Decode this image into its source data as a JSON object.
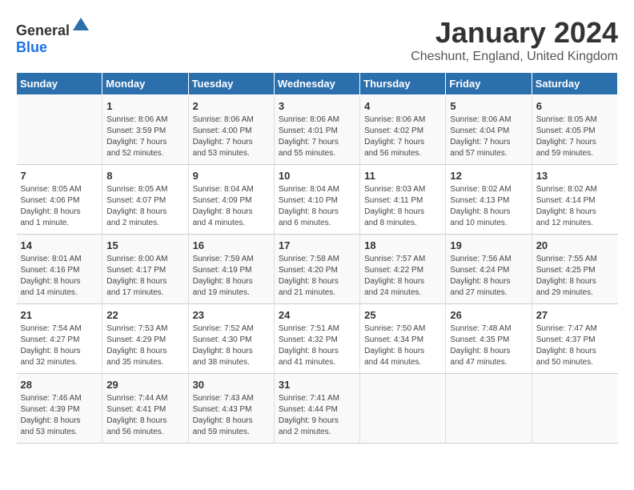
{
  "logo": {
    "text_general": "General",
    "text_blue": "Blue"
  },
  "header": {
    "title": "January 2024",
    "subtitle": "Cheshunt, England, United Kingdom"
  },
  "weekdays": [
    "Sunday",
    "Monday",
    "Tuesday",
    "Wednesday",
    "Thursday",
    "Friday",
    "Saturday"
  ],
  "weeks": [
    [
      {
        "day": "",
        "info": ""
      },
      {
        "day": "1",
        "info": "Sunrise: 8:06 AM\nSunset: 3:59 PM\nDaylight: 7 hours\nand 52 minutes."
      },
      {
        "day": "2",
        "info": "Sunrise: 8:06 AM\nSunset: 4:00 PM\nDaylight: 7 hours\nand 53 minutes."
      },
      {
        "day": "3",
        "info": "Sunrise: 8:06 AM\nSunset: 4:01 PM\nDaylight: 7 hours\nand 55 minutes."
      },
      {
        "day": "4",
        "info": "Sunrise: 8:06 AM\nSunset: 4:02 PM\nDaylight: 7 hours\nand 56 minutes."
      },
      {
        "day": "5",
        "info": "Sunrise: 8:06 AM\nSunset: 4:04 PM\nDaylight: 7 hours\nand 57 minutes."
      },
      {
        "day": "6",
        "info": "Sunrise: 8:05 AM\nSunset: 4:05 PM\nDaylight: 7 hours\nand 59 minutes."
      }
    ],
    [
      {
        "day": "7",
        "info": "Sunrise: 8:05 AM\nSunset: 4:06 PM\nDaylight: 8 hours\nand 1 minute."
      },
      {
        "day": "8",
        "info": "Sunrise: 8:05 AM\nSunset: 4:07 PM\nDaylight: 8 hours\nand 2 minutes."
      },
      {
        "day": "9",
        "info": "Sunrise: 8:04 AM\nSunset: 4:09 PM\nDaylight: 8 hours\nand 4 minutes."
      },
      {
        "day": "10",
        "info": "Sunrise: 8:04 AM\nSunset: 4:10 PM\nDaylight: 8 hours\nand 6 minutes."
      },
      {
        "day": "11",
        "info": "Sunrise: 8:03 AM\nSunset: 4:11 PM\nDaylight: 8 hours\nand 8 minutes."
      },
      {
        "day": "12",
        "info": "Sunrise: 8:02 AM\nSunset: 4:13 PM\nDaylight: 8 hours\nand 10 minutes."
      },
      {
        "day": "13",
        "info": "Sunrise: 8:02 AM\nSunset: 4:14 PM\nDaylight: 8 hours\nand 12 minutes."
      }
    ],
    [
      {
        "day": "14",
        "info": "Sunrise: 8:01 AM\nSunset: 4:16 PM\nDaylight: 8 hours\nand 14 minutes."
      },
      {
        "day": "15",
        "info": "Sunrise: 8:00 AM\nSunset: 4:17 PM\nDaylight: 8 hours\nand 17 minutes."
      },
      {
        "day": "16",
        "info": "Sunrise: 7:59 AM\nSunset: 4:19 PM\nDaylight: 8 hours\nand 19 minutes."
      },
      {
        "day": "17",
        "info": "Sunrise: 7:58 AM\nSunset: 4:20 PM\nDaylight: 8 hours\nand 21 minutes."
      },
      {
        "day": "18",
        "info": "Sunrise: 7:57 AM\nSunset: 4:22 PM\nDaylight: 8 hours\nand 24 minutes."
      },
      {
        "day": "19",
        "info": "Sunrise: 7:56 AM\nSunset: 4:24 PM\nDaylight: 8 hours\nand 27 minutes."
      },
      {
        "day": "20",
        "info": "Sunrise: 7:55 AM\nSunset: 4:25 PM\nDaylight: 8 hours\nand 29 minutes."
      }
    ],
    [
      {
        "day": "21",
        "info": "Sunrise: 7:54 AM\nSunset: 4:27 PM\nDaylight: 8 hours\nand 32 minutes."
      },
      {
        "day": "22",
        "info": "Sunrise: 7:53 AM\nSunset: 4:29 PM\nDaylight: 8 hours\nand 35 minutes."
      },
      {
        "day": "23",
        "info": "Sunrise: 7:52 AM\nSunset: 4:30 PM\nDaylight: 8 hours\nand 38 minutes."
      },
      {
        "day": "24",
        "info": "Sunrise: 7:51 AM\nSunset: 4:32 PM\nDaylight: 8 hours\nand 41 minutes."
      },
      {
        "day": "25",
        "info": "Sunrise: 7:50 AM\nSunset: 4:34 PM\nDaylight: 8 hours\nand 44 minutes."
      },
      {
        "day": "26",
        "info": "Sunrise: 7:48 AM\nSunset: 4:35 PM\nDaylight: 8 hours\nand 47 minutes."
      },
      {
        "day": "27",
        "info": "Sunrise: 7:47 AM\nSunset: 4:37 PM\nDaylight: 8 hours\nand 50 minutes."
      }
    ],
    [
      {
        "day": "28",
        "info": "Sunrise: 7:46 AM\nSunset: 4:39 PM\nDaylight: 8 hours\nand 53 minutes."
      },
      {
        "day": "29",
        "info": "Sunrise: 7:44 AM\nSunset: 4:41 PM\nDaylight: 8 hours\nand 56 minutes."
      },
      {
        "day": "30",
        "info": "Sunrise: 7:43 AM\nSunset: 4:43 PM\nDaylight: 8 hours\nand 59 minutes."
      },
      {
        "day": "31",
        "info": "Sunrise: 7:41 AM\nSunset: 4:44 PM\nDaylight: 9 hours\nand 2 minutes."
      },
      {
        "day": "",
        "info": ""
      },
      {
        "day": "",
        "info": ""
      },
      {
        "day": "",
        "info": ""
      }
    ]
  ]
}
